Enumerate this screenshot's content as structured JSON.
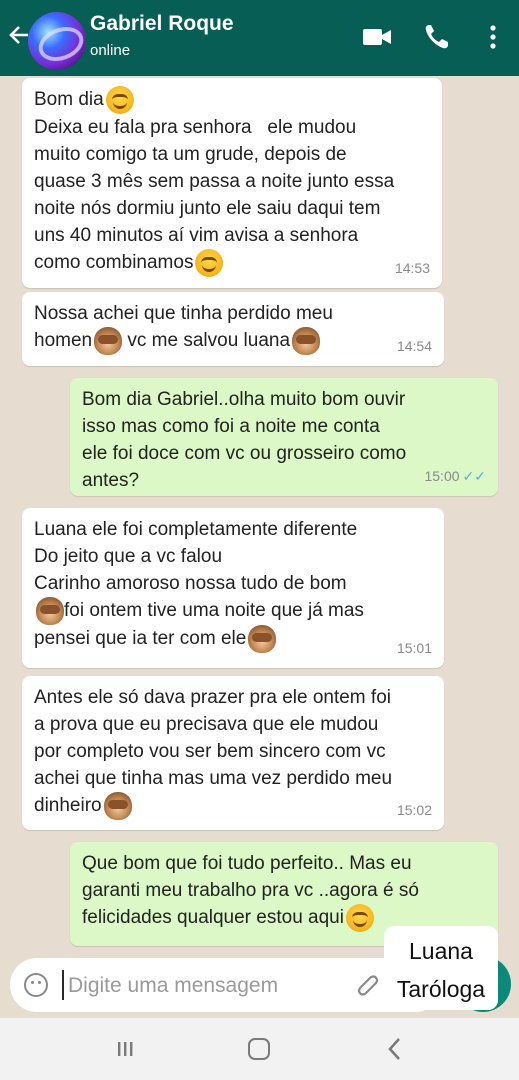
{
  "header": {
    "contact_name": "Gabriel Roque",
    "status": "online",
    "icons": [
      "back-arrow-icon",
      "video-call-icon",
      "phone-icon",
      "more-options-icon"
    ]
  },
  "messages": [
    {
      "dir": "in",
      "text": "Bom dia",
      "time": "",
      "emoji_end": "smile"
    },
    {
      "dir": "in",
      "text": "Deixa eu fala pra senhora   ele mudou\nmuito comigo ta um grude, depois de\nquase 3 mês sem passa a noite junto essa\nnoite nós dormiu junto ele saiu daqui tem\nuns 40 minutos aí vim avisa a senhora\ncomo combinamos",
      "time": "14:53",
      "emoji_end": "smile"
    },
    {
      "dir": "in",
      "text_parts": [
        "Nossa achei que tinha perdido meu\nhomen",
        " vc me salvou luana"
      ],
      "time": "14:54"
    },
    {
      "dir": "out",
      "text": "Bom dia Gabriel..olha muito bom ouvir\nisso mas como foi a noite me conta\nele foi doce com vc ou grosseiro como\nantes?",
      "time": "15:00",
      "read": true
    },
    {
      "dir": "in",
      "text_parts": [
        "Luana ele foi completamente diferente\nDo jeito que a vc falou\nCarinho amoroso nossa tudo de bom\n",
        "foi ontem tive uma noite que já mas\npensei que ia ter com ele"
      ],
      "time": "15:01"
    },
    {
      "dir": "in",
      "text_parts": [
        "Antes ele só dava prazer pra ele ontem foi\na prova que eu precisava que ele mudou\npor completo vou ser bem sincero com vc\nachei que tinha mas uma vez perdido meu\ndinheiro"
      ],
      "time": "15:02"
    },
    {
      "dir": "out",
      "text": "Que bom que foi tudo perfeito.. Mas eu\ngaranti meu trabalho pra vc ..agora é só\nfelicidades qualquer estou aqui",
      "time": ""
    }
  ],
  "input": {
    "placeholder": "Digite uma mensagem"
  },
  "watermark": {
    "line1": "Luana",
    "line2": "Taróloga"
  },
  "colors": {
    "header": "#075e54",
    "outgoing": "#dcf8c6",
    "incoming": "#ffffff",
    "read_tick": "#4fb6ec"
  }
}
